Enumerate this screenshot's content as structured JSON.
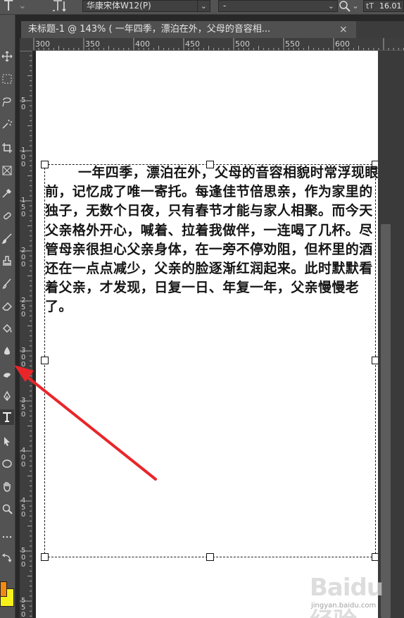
{
  "options_bar": {
    "font_family": "华康宋体W12(P)",
    "font_style": "-",
    "font_size": "16.01"
  },
  "document_tab": {
    "title": "未标题-1 @ 143% (      一年四季，漂泊在外，父母的音容相...",
    "close_glyph": "×"
  },
  "ruler_top": [
    "300",
    "350",
    "400",
    "450",
    "500",
    "550",
    "600"
  ],
  "ruler_left": [
    "5\n0",
    "1\n0\n0",
    "1\n5\n0",
    "2\n0\n0",
    "2\n5\n0",
    "3\n0\n0",
    "3\n5\n0",
    "4\n0\n0",
    "4\n5\n0",
    "5\n0\n0",
    "5\n5\n0"
  ],
  "text_layer": {
    "content": "一年四季，漂泊在外，父母的音容相貌时常浮现眼前，记忆成了唯一寄托。每逢佳节倍思亲，作为家里的独子，无数个日夜，只有春节才能与家人相聚。而今天父亲格外开心，喊着、拉着我做伴，一连喝了几杯。尽管母亲很担心父亲身体，在一旁不停劝阻，但杯里的酒还在一点点减少，父亲的脸逐渐红润起来。此时默默看着父亲，才发现，日复一日、年复一年，父亲慢慢老了。"
  },
  "colors": {
    "foreground": "#f28a10",
    "background": "#f7f11a",
    "annotation_arrow": "#e8262a"
  },
  "watermark": {
    "logo": "Baidu经验",
    "url": "jingyan.baidu.com"
  },
  "tools": [
    "move-tool",
    "marquee-tool",
    "lasso-tool",
    "quick-select-tool",
    "crop-tool",
    "frame-tool",
    "eyedropper-tool",
    "healing-brush-tool",
    "brush-tool",
    "clone-stamp-tool",
    "history-brush-tool",
    "eraser-tool",
    "gradient-tool",
    "blur-tool",
    "dodge-tool",
    "pen-tool",
    "type-tool",
    "path-select-tool",
    "shape-tool",
    "hand-tool",
    "zoom-tool",
    "more-tools"
  ]
}
